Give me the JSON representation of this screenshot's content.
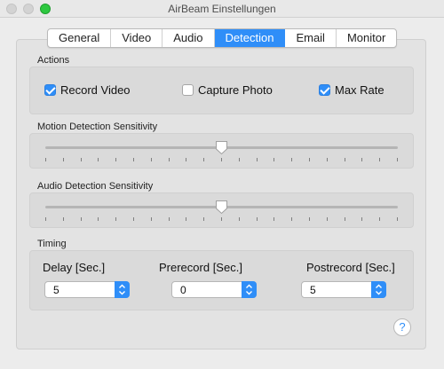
{
  "window": {
    "title": "AirBeam Einstellungen"
  },
  "tabs": [
    {
      "label": "General",
      "active": false
    },
    {
      "label": "Video",
      "active": false
    },
    {
      "label": "Audio",
      "active": false
    },
    {
      "label": "Detection",
      "active": true
    },
    {
      "label": "Email",
      "active": false
    },
    {
      "label": "Monitor",
      "active": false
    }
  ],
  "actions": {
    "label": "Actions",
    "record_video": {
      "label": "Record Video",
      "checked": true
    },
    "capture_photo": {
      "label": "Capture Photo",
      "checked": false
    },
    "max_rate": {
      "label": "Max Rate",
      "checked": true
    }
  },
  "motion": {
    "label": "Motion Detection Sensitivity",
    "value_fraction": 0.5
  },
  "audio": {
    "label": "Audio Detection Sensitivity",
    "value_fraction": 0.5
  },
  "timing": {
    "label": "Timing",
    "delay": {
      "label": "Delay [Sec.]",
      "value": "5"
    },
    "prerecord": {
      "label": "Prerecord [Sec.]",
      "value": "0"
    },
    "postrecord": {
      "label": "Postrecord [Sec.]",
      "value": "5"
    }
  },
  "help": {
    "glyph": "?"
  },
  "colors": {
    "accent": "#2f8ef8",
    "zoom_button": "#2dc840"
  }
}
